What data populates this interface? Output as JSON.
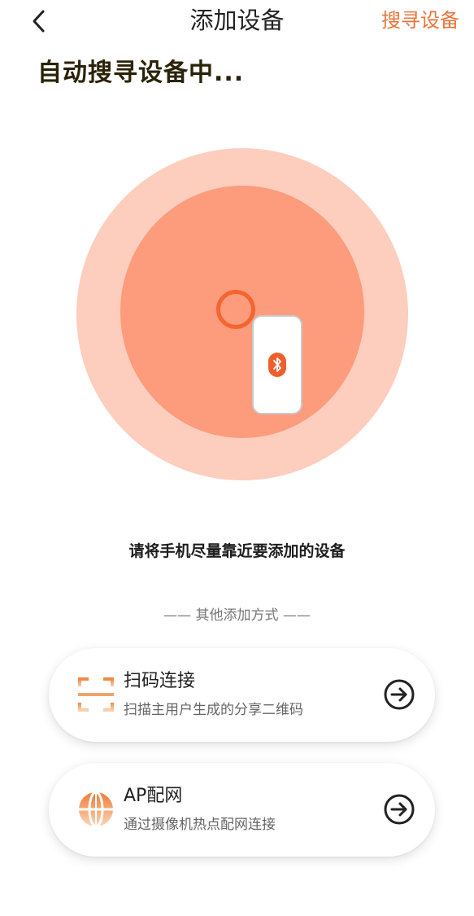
{
  "header": {
    "title": "添加设备",
    "search_label": "搜寻设备",
    "back_icon": "chevron-left-icon"
  },
  "status": {
    "heading": "自动搜寻设备中..."
  },
  "radar": {
    "icons": [
      "search-ring-icon",
      "phone-icon",
      "bluetooth-icon"
    ]
  },
  "hint": "请将手机尽量靠近要添加的设备",
  "other_methods": {
    "label": "—— 其他添加方式 ——",
    "options": [
      {
        "title": "扫码连接",
        "subtitle": "扫描主用户生成的分享二维码",
        "icon": "scan-frame-icon"
      },
      {
        "title": "AP配网",
        "subtitle": "通过摄像机热点配网连接",
        "icon": "globe-icon"
      }
    ]
  },
  "colors": {
    "accent": "#e8743b",
    "radar_outer": "#fdcdbd",
    "radar_inner": "#fc9c7c",
    "ring": "#f46530",
    "bluetooth_badge": "#ef5f2b"
  }
}
